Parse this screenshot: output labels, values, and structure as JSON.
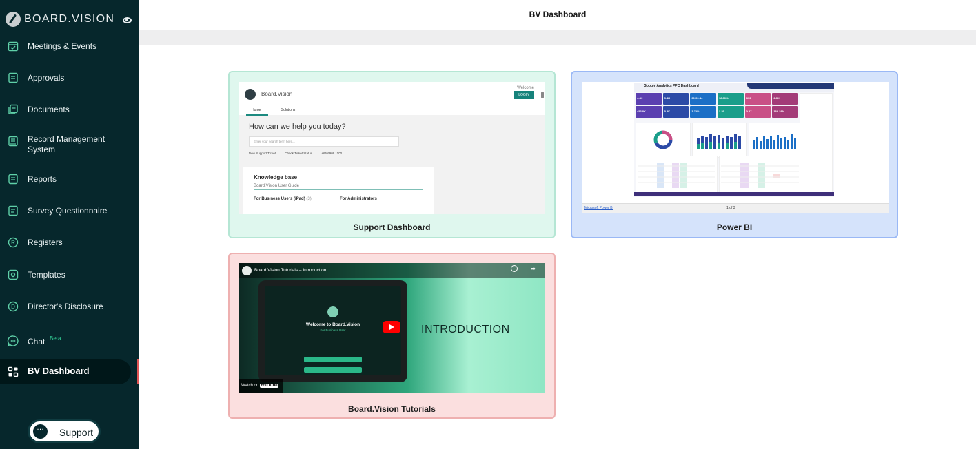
{
  "app": {
    "brand": "BOARD.VISION"
  },
  "header": {
    "title": "BV Dashboard"
  },
  "sidebar": {
    "items": [
      {
        "label": "Meetings & Events",
        "icon": "calendar-check-icon"
      },
      {
        "label": "Approvals",
        "icon": "approval-doc-icon"
      },
      {
        "label": "Documents",
        "icon": "documents-icon"
      },
      {
        "label": "Record Management System",
        "icon": "record-management-icon"
      },
      {
        "label": "Reports",
        "icon": "reports-icon"
      },
      {
        "label": "Survey Questionnaire",
        "icon": "survey-icon"
      },
      {
        "label": "Registers",
        "icon": "registered-icon"
      },
      {
        "label": "Templates",
        "icon": "templates-icon"
      },
      {
        "label": "Director's Disclosure",
        "icon": "disclosure-icon"
      },
      {
        "label": "Chat",
        "icon": "chat-icon",
        "badge": "Beta"
      },
      {
        "label": "BV Dashboard",
        "icon": "dashboard-grid-icon",
        "active": true
      }
    ],
    "support_label": "Support"
  },
  "cards": {
    "support": {
      "title": "Support Dashboard",
      "preview": {
        "brand": "Board.Vision",
        "welcome": "Welcome",
        "login": "LOGIN",
        "tabs": [
          "Home",
          "Solutions"
        ],
        "heading": "How can we help you today?",
        "search_placeholder": "Enter your search term here...",
        "links": [
          "New Support Ticket",
          "Check Ticket Status",
          "+65 6909 1100"
        ],
        "kb_title": "Knowledge base",
        "kb_guide": "Board.Vision User Guide",
        "kb_col_a": "For Business Users (iPad)",
        "kb_col_a_count": "(3)",
        "kb_col_b": "For Administrators"
      }
    },
    "powerbi": {
      "title": "Power BI",
      "preview": {
        "dash_title": "Google Analytics PPC Dashboard",
        "kpis": [
          "4.4K",
          "5.4K",
          "00:00:44",
          "18.60%",
          "813",
          "2.8K",
          "453.8K",
          "5.5K",
          "1.22%",
          "3.39",
          "0.27",
          "185.38%"
        ],
        "link": "Microsoft Power BI",
        "pager": "1 of 3"
      }
    },
    "tutorials": {
      "title": "Board.Vision Tutorials",
      "preview": {
        "video_title": "Board.Vision Tutorials – Introduction",
        "welcome": "Welcome to Board.Vision",
        "for_business": "For Business User",
        "intro": "INTRODUCTION",
        "watch_on": "Watch on",
        "youtube": "YouTube"
      }
    }
  },
  "colors": {
    "sidebar_bg": "#06272c",
    "accent_teal": "#16827b",
    "support_card_bg": "#dff7ee",
    "powerbi_card_bg": "#d5e3fb",
    "tutorials_card_bg": "#fbdfdf",
    "active_indicator": "#e05555"
  }
}
